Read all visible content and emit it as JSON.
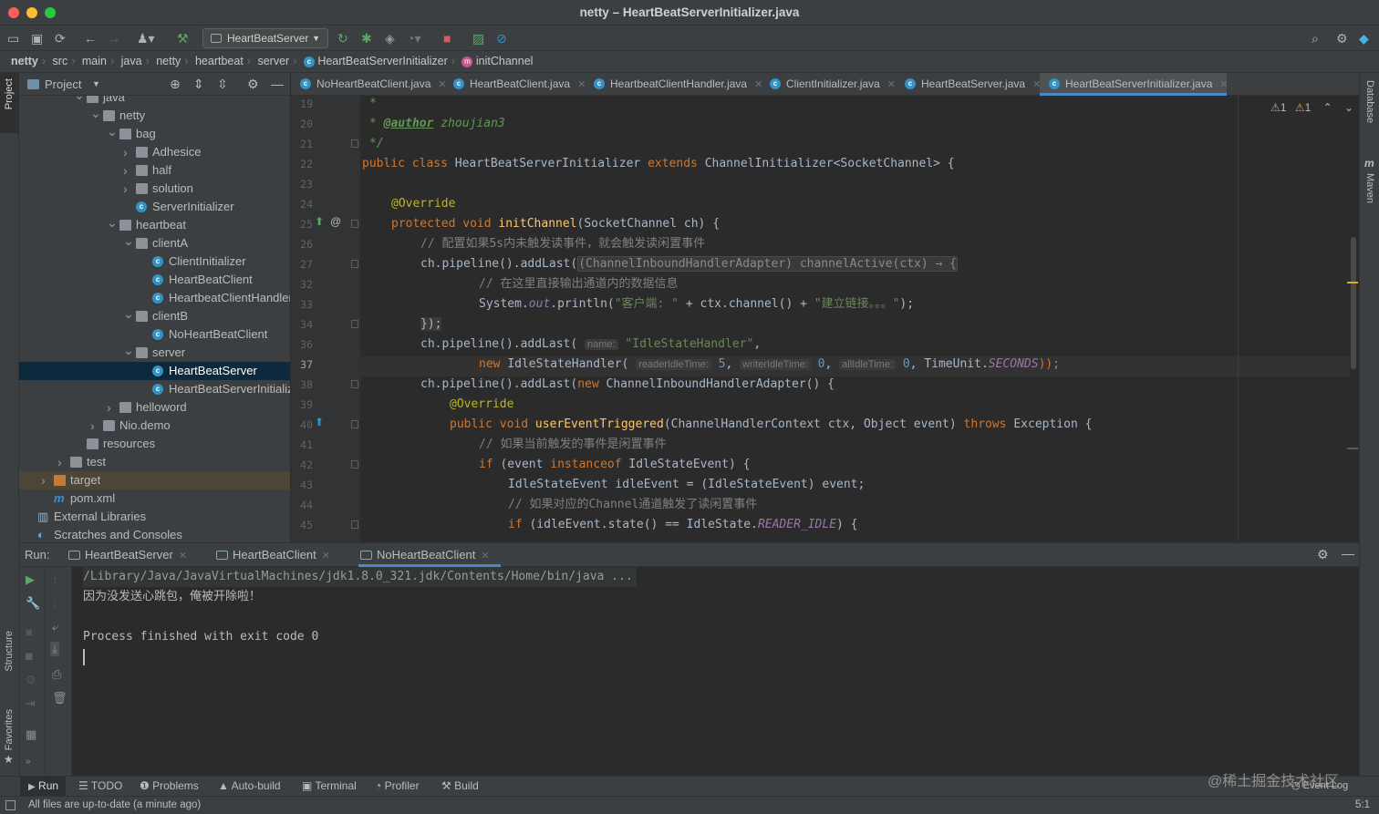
{
  "window": {
    "title": "netty – HeartBeatServerInitializer.java"
  },
  "toolbar": {
    "run_config": "HeartBeatServer"
  },
  "breadcrumb": [
    "netty",
    "src",
    "main",
    "java",
    "netty",
    "heartbeat",
    "server",
    "HeartBeatServerInitializer",
    "initChannel"
  ],
  "left_strip": {
    "project": "Project",
    "structure": "Structure",
    "favorites": "Favorites"
  },
  "right_strip": {
    "database": "Database",
    "maven": "Maven"
  },
  "project_panel": {
    "title": "Project"
  },
  "tree": [
    {
      "label": "java",
      "kind": "folder",
      "depth": 3,
      "arrow": "down"
    },
    {
      "label": "netty",
      "kind": "folder",
      "depth": 4,
      "arrow": "down"
    },
    {
      "label": "bag",
      "kind": "folder",
      "depth": 5,
      "arrow": "down"
    },
    {
      "label": "Adhesice",
      "kind": "folder",
      "depth": 6,
      "arrow": "right"
    },
    {
      "label": "half",
      "kind": "folder",
      "depth": 6,
      "arrow": "right"
    },
    {
      "label": "solution",
      "kind": "folder",
      "depth": 6,
      "arrow": "right"
    },
    {
      "label": "ServerInitializer",
      "kind": "class",
      "depth": 6,
      "arrow": ""
    },
    {
      "label": "heartbeat",
      "kind": "folder",
      "depth": 5,
      "arrow": "down"
    },
    {
      "label": "clientA",
      "kind": "folder",
      "depth": 6,
      "arrow": "down"
    },
    {
      "label": "ClientInitializer",
      "kind": "class",
      "depth": 7,
      "arrow": ""
    },
    {
      "label": "HeartBeatClient",
      "kind": "class",
      "depth": 7,
      "arrow": ""
    },
    {
      "label": "HeartbeatClientHandler",
      "kind": "class",
      "depth": 7,
      "arrow": ""
    },
    {
      "label": "clientB",
      "kind": "folder",
      "depth": 6,
      "arrow": "down"
    },
    {
      "label": "NoHeartBeatClient",
      "kind": "class",
      "depth": 7,
      "arrow": ""
    },
    {
      "label": "server",
      "kind": "folder",
      "depth": 6,
      "arrow": "down"
    },
    {
      "label": "HeartBeatServer",
      "kind": "class",
      "depth": 7,
      "arrow": "",
      "selected": true
    },
    {
      "label": "HeartBeatServerInitializ",
      "kind": "class",
      "depth": 7,
      "arrow": ""
    },
    {
      "label": "helloword",
      "kind": "folder",
      "depth": 5,
      "arrow": "right"
    },
    {
      "label": "Nio.demo",
      "kind": "folder",
      "depth": 4,
      "arrow": "right"
    },
    {
      "label": "resources",
      "kind": "folder",
      "depth": 3,
      "arrow": ""
    },
    {
      "label": "test",
      "kind": "folder",
      "depth": 2,
      "arrow": "right"
    },
    {
      "label": "target",
      "kind": "folder-orange",
      "depth": 1,
      "arrow": "right",
      "highlight": true
    },
    {
      "label": "pom.xml",
      "kind": "maven",
      "depth": 1,
      "arrow": ""
    },
    {
      "label": "External Libraries",
      "kind": "lib",
      "depth": 0,
      "arrow": ""
    },
    {
      "label": "Scratches and Consoles",
      "kind": "scratch",
      "depth": 0,
      "arrow": ""
    }
  ],
  "editor_tabs": [
    {
      "label": "NoHeartBeatClient.java",
      "active": false
    },
    {
      "label": "HeartBeatClient.java",
      "active": false
    },
    {
      "label": "HeartbeatClientHandler.java",
      "active": false
    },
    {
      "label": "ClientInitializer.java",
      "active": false
    },
    {
      "label": "HeartBeatServer.java",
      "active": false
    },
    {
      "label": "HeartBeatServerInitializer.java",
      "active": true
    }
  ],
  "inspection": {
    "warnings": "1",
    "weak_warnings": "1"
  },
  "line_numbers": [
    "19",
    "20",
    "21",
    "22",
    "23",
    "24",
    "25",
    "26",
    "27",
    "32",
    "33",
    "34",
    "36",
    "37",
    "38",
    "39",
    "40",
    "41",
    "42",
    "43",
    "44",
    "45"
  ],
  "current_line": "37",
  "code": {
    "l19": "*",
    "l20a": "* ",
    "l20b": "@author",
    "l20c": " zhoujian3",
    "l21": "*/",
    "l22a": "public class ",
    "l22b": "HeartBeatServerInitializer ",
    "l22c": "extends ",
    "l22d": "ChannelInitializer<SocketChannel> {",
    "l24": "@Override",
    "l25a": "protected void ",
    "l25b": "initChannel",
    "l25c": "(SocketChannel ch) {",
    "l26": "// 配置如果5s内未触发读事件，就会触发读闲置事件",
    "l27a": "ch.pipeline().addLast(",
    "l27b": "(ChannelInboundHandlerAdapter) channelActive(ctx) → {",
    "l32": "// 在这里直接输出通道内的数据信息",
    "l33a": "System.",
    "l33b": "out",
    "l33c": ".println(",
    "l33d": "\"客户端: \"",
    "l33e": " + ctx.channel() + ",
    "l33f": "\"建立链接。。。\"",
    "l33g": ");",
    "l34": "});",
    "l36a": "ch.pipeline().addLast( ",
    "l36h": "name:",
    "l36b": " \"IdleStateHandler\"",
    "l36c": ",",
    "l37a": "new ",
    "l37b": "IdleStateHandler( ",
    "l37h1": "readerIdleTime:",
    "l37n1": " 5",
    "l37c": ", ",
    "l37h2": "writerIdleTime:",
    "l37n2": " 0",
    "l37d": ", ",
    "l37h3": "allIdleTime:",
    "l37n3": " 0",
    "l37e": ", TimeUnit.",
    "l37f": "SECONDS",
    "l37g": "));",
    "l38a": "ch.pipeline().addLast(",
    "l38b": "new ",
    "l38c": "ChannelInboundHandlerAdapter() {",
    "l39": "@Override",
    "l40a": "public void ",
    "l40b": "userEventTriggered",
    "l40c": "(ChannelHandlerContext ctx, Object event) ",
    "l40d": "throws ",
    "l40e": "Exception {",
    "l41": "// 如果当前触发的事件是闲置事件",
    "l42a": "if ",
    "l42b": "(event ",
    "l42c": "instanceof ",
    "l42d": "IdleStateEvent) {",
    "l43": "IdleStateEvent idleEvent = (IdleStateEvent) event;",
    "l44": "// 如果对应的Channel通道触发了读闲置事件",
    "l45a": "if ",
    "l45b": "(idleEvent.state() == IdleState.",
    "l45c": "READER_IDLE",
    "l45d": ") {"
  },
  "run_panel": {
    "label": "Run:",
    "tabs": [
      {
        "label": "HeartBeatServer",
        "active": false
      },
      {
        "label": "HeartBeatClient",
        "active": false
      },
      {
        "label": "NoHeartBeatClient",
        "active": true
      }
    ],
    "console": [
      "/Library/Java/JavaVirtualMachines/jdk1.8.0_321.jdk/Contents/Home/bin/java ...",
      "因为没发送心跳包，俺被开除啦！",
      "",
      "Process finished with exit code 0"
    ]
  },
  "bottom_tabs": [
    "Run",
    "TODO",
    "Problems",
    "Auto-build",
    "Terminal",
    "Profiler",
    "Build"
  ],
  "event_log": "Event Log",
  "watermark": "@稀土掘金技术社区",
  "status": {
    "message": "All files are up-to-date (a minute ago)",
    "position": "5:1"
  },
  "colors": {
    "accent": "#4a88c7",
    "selection": "#0d293e",
    "keyword": "#cc7832",
    "string": "#6a8759",
    "comment": "#808080",
    "annotation": "#bbb529",
    "method": "#ffc66d"
  }
}
